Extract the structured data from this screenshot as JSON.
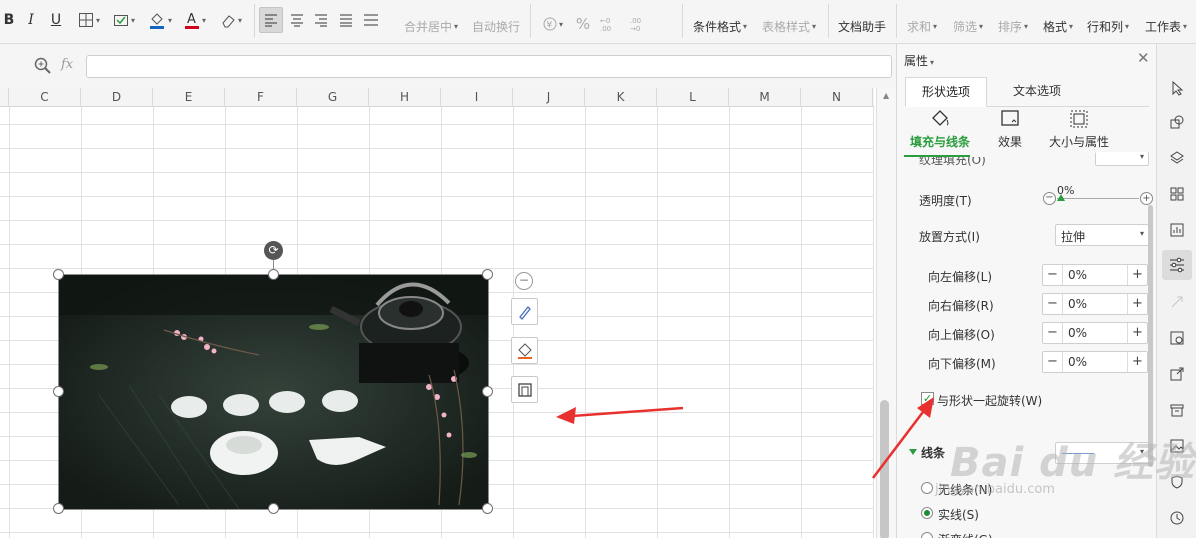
{
  "toolbar": {
    "bold": "B",
    "italic": "I",
    "underline": "U",
    "merge_center": "合并居中",
    "wrap_text": "自动换行",
    "percent": "%",
    "cond_format": "条件格式",
    "table_style": "表格样式",
    "doc_helper": "文档助手",
    "sum": "求和",
    "filter": "筛选",
    "sort": "排序",
    "format": "格式",
    "rows_cols": "行和列",
    "worksheet": "工作表",
    "font_color": "#d0021b",
    "fill_color": "#1565c0"
  },
  "formula_bar": {
    "fx_label": "fx",
    "value": ""
  },
  "columns": [
    "C",
    "D",
    "E",
    "F",
    "G",
    "H",
    "I",
    "J",
    "K",
    "L",
    "M",
    "N"
  ],
  "panel": {
    "title": "属性",
    "tabs": [
      {
        "label": "形状选项",
        "active": true
      },
      {
        "label": "文本选项",
        "active": false
      }
    ],
    "subtabs": [
      {
        "label": "填充与线条",
        "active": true
      },
      {
        "label": "效果",
        "active": false
      },
      {
        "label": "大小与属性",
        "active": false
      }
    ],
    "cut_label": "纹理填充(O)",
    "transparency": {
      "label": "透明度(T)",
      "value": "0%"
    },
    "placement": {
      "label": "放置方式(I)",
      "value": "拉伸"
    },
    "offsets": [
      {
        "label": "向左偏移(L)",
        "value": "0%"
      },
      {
        "label": "向右偏移(R)",
        "value": "0%"
      },
      {
        "label": "向上偏移(O)",
        "value": "0%"
      },
      {
        "label": "向下偏移(M)",
        "value": "0%"
      }
    ],
    "rotate_with_shape": {
      "label": "与形状一起旋转(W)",
      "checked": true
    },
    "line_section": {
      "label": "线条"
    },
    "line_options": [
      {
        "label": "无线条(N)",
        "selected": false
      },
      {
        "label": "实线(S)",
        "selected": true
      },
      {
        "label": "渐变线(G)",
        "selected": false
      }
    ]
  },
  "watermark": {
    "brand": "Bai du 经验",
    "url": "jingyan.baidu.com"
  },
  "colors": {
    "accent_green": "#2a9d3c",
    "annotation_red": "#e8312f"
  }
}
